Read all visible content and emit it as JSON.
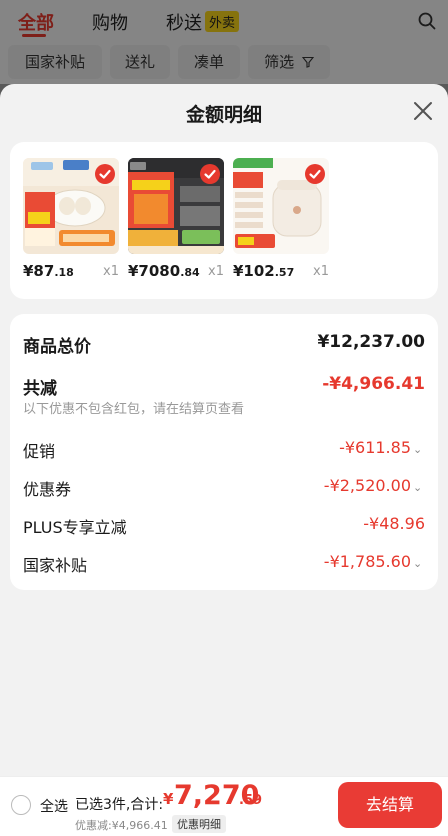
{
  "top_tabs": [
    {
      "label": "全部"
    },
    {
      "label": "购物"
    },
    {
      "label": "秒送",
      "badge": "外卖"
    }
  ],
  "filter_chips": [
    "国家补贴",
    "送礼",
    "凑单",
    "筛选"
  ],
  "sheet": {
    "title": "金额明细"
  },
  "products": [
    {
      "price_int": "¥87",
      "price_dec": ".18",
      "qty": "x1",
      "theme": "rice-cooker-egg"
    },
    {
      "price_int": "¥7080",
      "price_dec": ".84",
      "qty": "x1",
      "theme": "kitchen-set"
    },
    {
      "price_int": "¥102",
      "price_dec": ".57",
      "qty": "x1",
      "theme": "rice-cooker-white"
    }
  ],
  "amount": {
    "total_label": "商品总价",
    "total_value": "¥12,237.00",
    "reduce_label": "共减",
    "reduce_value": "-¥4,966.41",
    "reduce_note": "以下优惠不包含红包，请在结算页查看",
    "items": [
      {
        "label": "促销",
        "value": "-¥611.85",
        "expandable": true
      },
      {
        "label": "优惠券",
        "value": "-¥2,520.00",
        "expandable": true
      },
      {
        "label": "PLUS专享立减",
        "value": "-¥48.96",
        "expandable": false
      },
      {
        "label": "国家补贴",
        "value": "-¥1,785.60",
        "expandable": true
      }
    ]
  },
  "bottom_bar": {
    "select_all": "全选",
    "selected_info": "已选3件,合计:",
    "total_currency": "¥",
    "total_int": "7,270",
    "total_dec": ".59",
    "saved": "优惠减:¥4,966.41",
    "detail_link": "优惠明细",
    "checkout": "去结算"
  },
  "colors": {
    "accent": "#e6392e",
    "checkout_bg": "#e93b35",
    "sheet_bg": "#f2f2f2"
  }
}
